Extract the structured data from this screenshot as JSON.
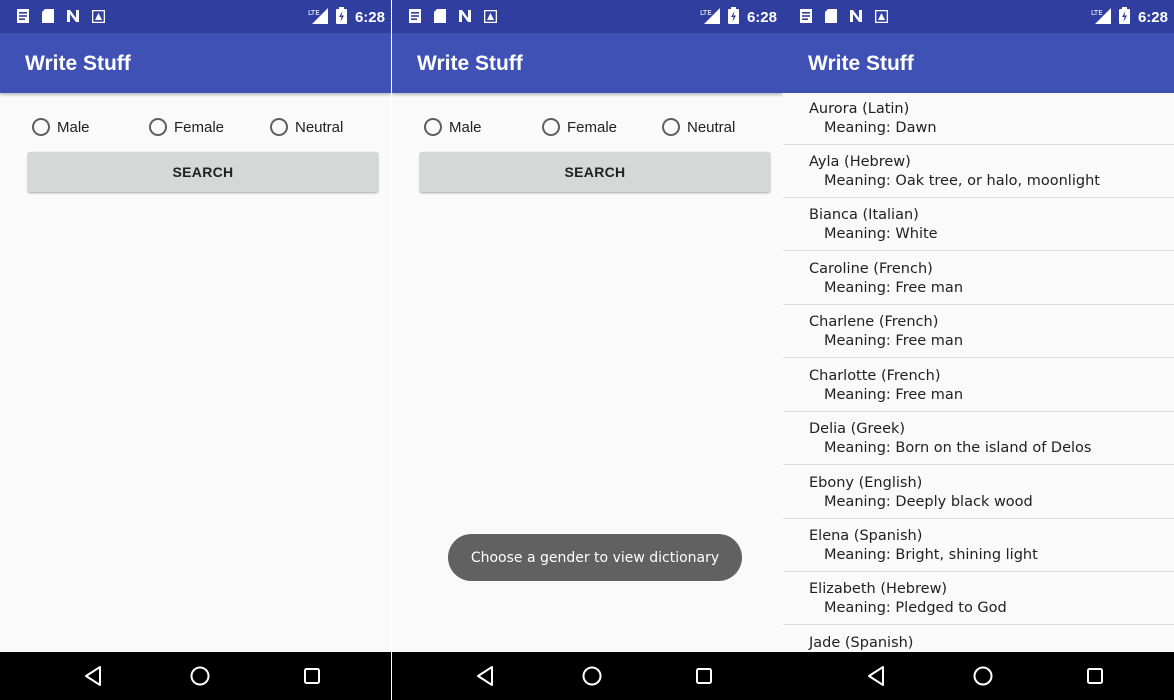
{
  "app": {
    "title": "Write Stuff"
  },
  "status_bar": {
    "time": "6:28",
    "network": "LTE"
  },
  "gender_options": [
    "Male",
    "Female",
    "Neutral"
  ],
  "search_button": {
    "label": "SEARCH"
  },
  "toast": {
    "message": "Choose a gender to view dictionary"
  },
  "names": [
    {
      "title": "Aurora (Latin)",
      "meaning": "Meaning: Dawn"
    },
    {
      "title": "Ayla (Hebrew)",
      "meaning": "Meaning: Oak tree, or halo, moonlight"
    },
    {
      "title": "Bianca (Italian)",
      "meaning": "Meaning: White"
    },
    {
      "title": "Caroline (French)",
      "meaning": "Meaning: Free man"
    },
    {
      "title": "Charlene (French)",
      "meaning": "Meaning: Free man"
    },
    {
      "title": "Charlotte (French)",
      "meaning": "Meaning: Free man"
    },
    {
      "title": "Delia (Greek)",
      "meaning": "Meaning: Born on the island of Delos"
    },
    {
      "title": "Ebony (English)",
      "meaning": "Meaning: Deeply black wood"
    },
    {
      "title": "Elena (Spanish)",
      "meaning": "Meaning: Bright, shining light"
    },
    {
      "title": "Elizabeth (Hebrew)",
      "meaning": "Meaning: Pledged to God"
    },
    {
      "title": "Jade (Spanish)",
      "meaning": ""
    }
  ],
  "colors": {
    "primary": "#3f51b5",
    "primary_dark": "#303f9f",
    "background": "#fafafa",
    "button": "#d6d7d7",
    "toast": "#616161"
  },
  "icons": {
    "status_left": [
      "notes-icon",
      "sd-card-icon",
      "n-icon",
      "a-icon"
    ],
    "status_right": [
      "lte-signal-icon",
      "battery-charging-icon"
    ],
    "nav": [
      "back-icon",
      "home-icon",
      "recents-icon"
    ]
  }
}
